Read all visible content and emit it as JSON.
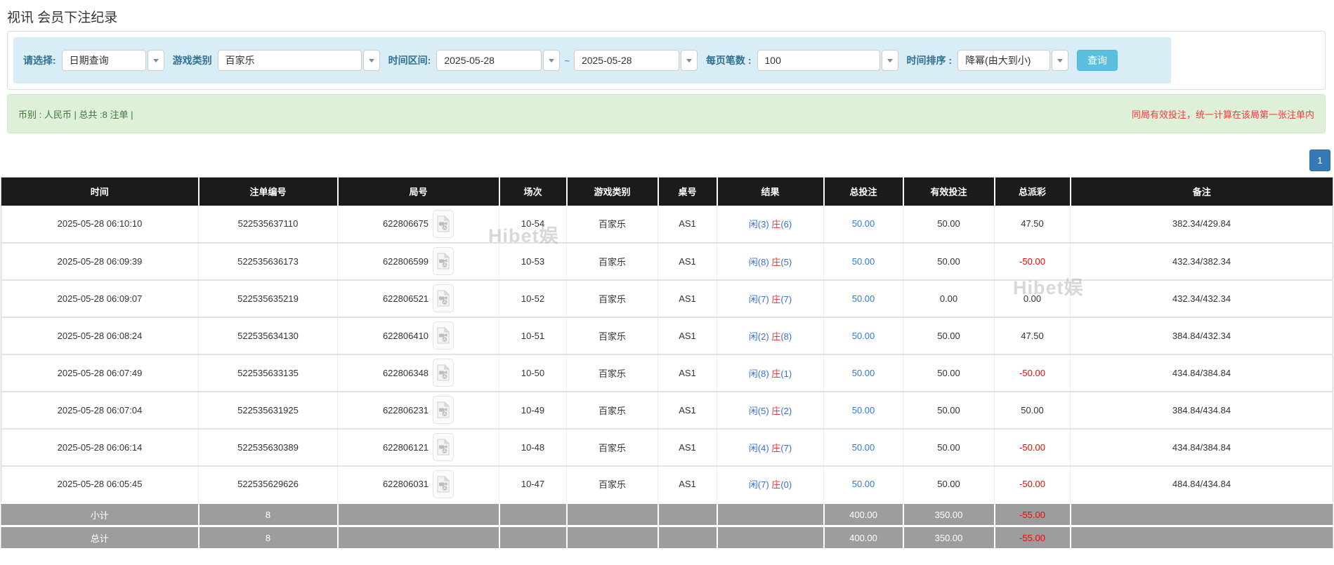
{
  "page_title": "视讯 会员下注纪录",
  "filters": {
    "query_type": {
      "label": "请选择:",
      "value": "日期查询"
    },
    "game_type": {
      "label": "游戏类别",
      "value": "百家乐"
    },
    "date_range": {
      "label": "时间区间:",
      "from": "2025-05-28",
      "separator": "~",
      "to": "2025-05-28"
    },
    "page_size": {
      "label": "每页笔数 :",
      "value": "100"
    },
    "sort": {
      "label": "时间排序 :",
      "value": "降幂(由大到小)"
    },
    "search_button": "查询"
  },
  "summary": {
    "left": "币别 : 人民币 | 总共 :8 注单 |",
    "notice": "同局有效投注，统一计算在该局第一张注单内"
  },
  "pagination": {
    "current": "1"
  },
  "watermark": "Hibet娱",
  "colors": {
    "link_blue": "#2d7bd9",
    "player_blue": "#3b6fd4",
    "banker_red": "#e4393c",
    "negative_red": "#ff0000",
    "search_button_blue": "#5bc0de",
    "pagination_blue": "#337ab7",
    "header_bg": "#1b1b1b",
    "subtotal_bg": "#9d9d9d",
    "filter_bg": "#d9edf7",
    "summary_bg": "#dff0d8"
  },
  "table": {
    "headers": [
      "时间",
      "注单编号",
      "局号",
      "场次",
      "游戏类别",
      "桌号",
      "结果",
      "总投注",
      "有效投注",
      "总派彩",
      "备注"
    ],
    "result_labels": {
      "player": "闲",
      "banker": "庄"
    },
    "rows": [
      {
        "time": "2025-05-28 06:10:10",
        "bet_id": "522535637110",
        "round_id": "622806675",
        "session": "10-54",
        "game": "百家乐",
        "table_no": "AS1",
        "player_points": "3",
        "banker_points": "6",
        "total_bet": "50.00",
        "valid_bet": "50.00",
        "payout": "47.50",
        "remark": "382.34/429.84"
      },
      {
        "time": "2025-05-28 06:09:39",
        "bet_id": "522535636173",
        "round_id": "622806599",
        "session": "10-53",
        "game": "百家乐",
        "table_no": "AS1",
        "player_points": "8",
        "banker_points": "5",
        "total_bet": "50.00",
        "valid_bet": "50.00",
        "payout": "-50.00",
        "remark": "432.34/382.34"
      },
      {
        "time": "2025-05-28 06:09:07",
        "bet_id": "522535635219",
        "round_id": "622806521",
        "session": "10-52",
        "game": "百家乐",
        "table_no": "AS1",
        "player_points": "7",
        "banker_points": "7",
        "total_bet": "50.00",
        "valid_bet": "0.00",
        "payout": "0.00",
        "remark": "432.34/432.34"
      },
      {
        "time": "2025-05-28 06:08:24",
        "bet_id": "522535634130",
        "round_id": "622806410",
        "session": "10-51",
        "game": "百家乐",
        "table_no": "AS1",
        "player_points": "2",
        "banker_points": "8",
        "total_bet": "50.00",
        "valid_bet": "50.00",
        "payout": "47.50",
        "remark": "384.84/432.34"
      },
      {
        "time": "2025-05-28 06:07:49",
        "bet_id": "522535633135",
        "round_id": "622806348",
        "session": "10-50",
        "game": "百家乐",
        "table_no": "AS1",
        "player_points": "8",
        "banker_points": "1",
        "total_bet": "50.00",
        "valid_bet": "50.00",
        "payout": "-50.00",
        "remark": "434.84/384.84"
      },
      {
        "time": "2025-05-28 06:07:04",
        "bet_id": "522535631925",
        "round_id": "622806231",
        "session": "10-49",
        "game": "百家乐",
        "table_no": "AS1",
        "player_points": "5",
        "banker_points": "2",
        "total_bet": "50.00",
        "valid_bet": "50.00",
        "payout": "50.00",
        "remark": "384.84/434.84"
      },
      {
        "time": "2025-05-28 06:06:14",
        "bet_id": "522535630389",
        "round_id": "622806121",
        "session": "10-48",
        "game": "百家乐",
        "table_no": "AS1",
        "player_points": "4",
        "banker_points": "7",
        "total_bet": "50.00",
        "valid_bet": "50.00",
        "payout": "-50.00",
        "remark": "434.84/384.84"
      },
      {
        "time": "2025-05-28 06:05:45",
        "bet_id": "522535629626",
        "round_id": "622806031",
        "session": "10-47",
        "game": "百家乐",
        "table_no": "AS1",
        "player_points": "7",
        "banker_points": "0",
        "total_bet": "50.00",
        "valid_bet": "50.00",
        "payout": "-50.00",
        "remark": "484.84/434.84"
      }
    ],
    "subtotal": {
      "label": "小计",
      "count": "8",
      "total_bet": "400.00",
      "valid_bet": "350.00",
      "payout": "-55.00"
    },
    "total": {
      "label": "总计",
      "count": "8",
      "total_bet": "400.00",
      "valid_bet": "350.00",
      "payout": "-55.00"
    }
  }
}
